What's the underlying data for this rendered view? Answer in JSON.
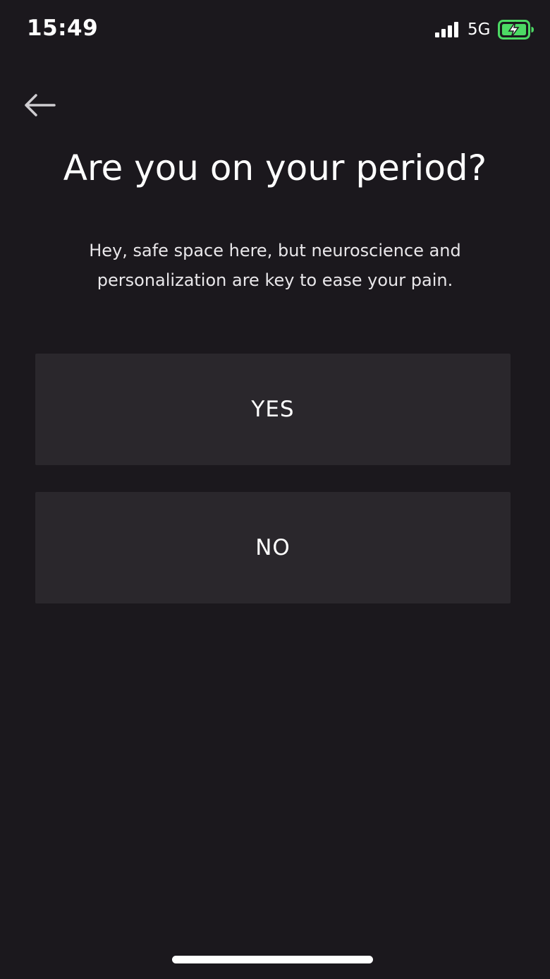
{
  "status_bar": {
    "time": "15:49",
    "network": "5G",
    "signal_bars": 4,
    "battery_state": "charging",
    "battery_color": "#4cd964"
  },
  "header": {
    "back_icon": "arrow-left-icon"
  },
  "question": {
    "title": "Are you on your period?",
    "subtitle": "Hey, safe space here, but neuroscience and personalization are key to ease your pain."
  },
  "options": [
    {
      "label": "YES"
    },
    {
      "label": "NO"
    }
  ],
  "colors": {
    "background": "#1b181d",
    "button_background": "#2a272c",
    "text": "#ffffff"
  }
}
